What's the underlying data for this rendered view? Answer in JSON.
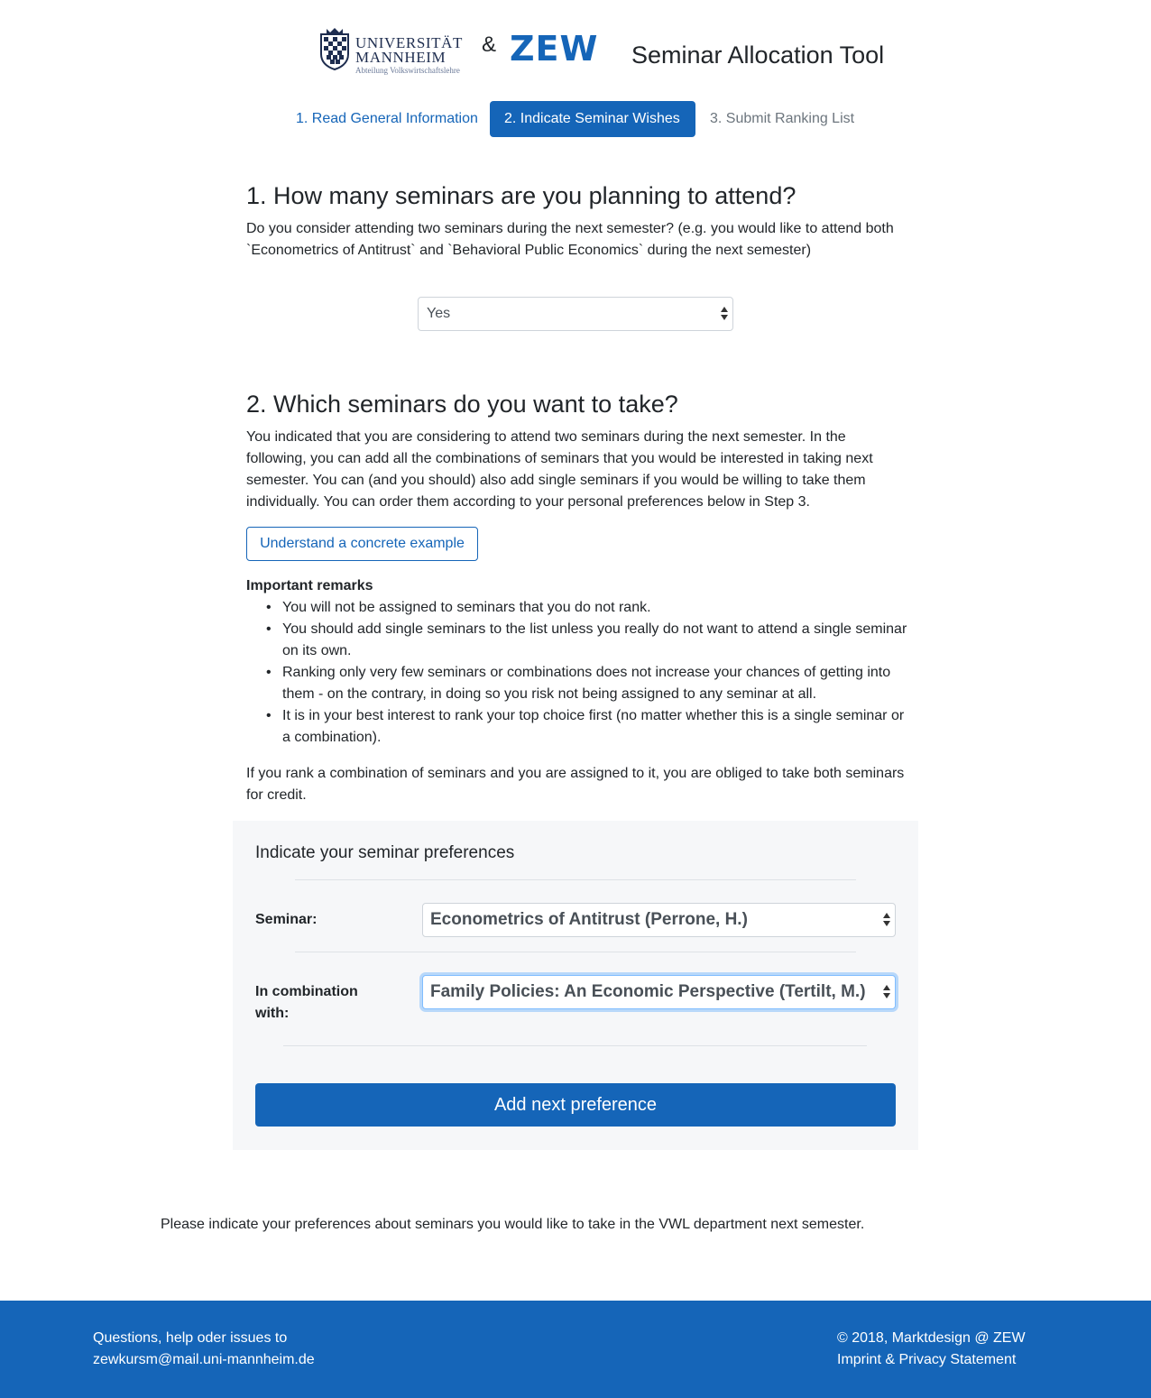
{
  "header": {
    "uni_logo_line1": "UNIVERSITÄT",
    "uni_logo_line2": "MANNHEIM",
    "uni_logo_line3": "Abteilung Volkswirtschaftslehre",
    "ampersand": "&",
    "zew_logo": "ZEW",
    "app_title": "Seminar Allocation Tool"
  },
  "steps": [
    {
      "label": "1. Read General Information",
      "state": "link"
    },
    {
      "label": "2. Indicate Seminar Wishes",
      "state": "active"
    },
    {
      "label": "3. Submit Ranking List",
      "state": "disabled"
    }
  ],
  "section1": {
    "title": "1. How many seminars are you planning to attend?",
    "text": "Do you consider attending two seminars during the next semester? (e.g. you would like to attend both `Econometrics of Antitrust` and `Behavioral Public Economics` during the next semester)",
    "select_value": "Yes"
  },
  "section2": {
    "title": "2. Which seminars do you want to take?",
    "text": "You indicated that you are considering to attend two seminars during the next semester. In the following, you can add all the combinations of seminars that you would be interested in taking next semester. You can (and you should) also add single seminars if you would be willing to take them individually. You can order them according to your personal preferences below in Step 3.",
    "example_button": "Understand a concrete example",
    "remarks_title": "Important remarks",
    "remarks": [
      "You will not be assigned to seminars that you do not rank.",
      "You should add single seminars to the list unless you really do not want to attend a single seminar on its own.",
      "Ranking only very few seminars or combinations does not increase your chances of getting into them - on the contrary, in doing so you risk not being assigned to any seminar at all.",
      "It is in your best interest to rank your top choice first (no matter whether this is a single seminar or a combination)."
    ],
    "obliged_text": "If you rank a combination of seminars and you are assigned to it, you are obliged to take both seminars for credit."
  },
  "preferences": {
    "title": "Indicate your seminar preferences",
    "seminar_label": "Seminar:",
    "seminar_value": "Econometrics of Antitrust (Perrone, H.)",
    "combination_label": "In combination with:",
    "combination_value": "Family Policies: An Economic Perspective (Tertilt, M.)",
    "add_button": "Add next preference"
  },
  "footer_note": "Please indicate your preferences about seminars you would like to take in the VWL department next semester.",
  "footer": {
    "help_text": "Questions, help oder issues to",
    "email": "zewkursm@mail.uni-mannheim.de",
    "copyright": "© 2018, Marktdesign @ ZEW",
    "imprint": "Imprint & Privacy Statement"
  },
  "colors": {
    "primary": "#1565b8",
    "card_bg": "#f6f7f9",
    "text": "#212529",
    "muted": "#6c757d"
  }
}
